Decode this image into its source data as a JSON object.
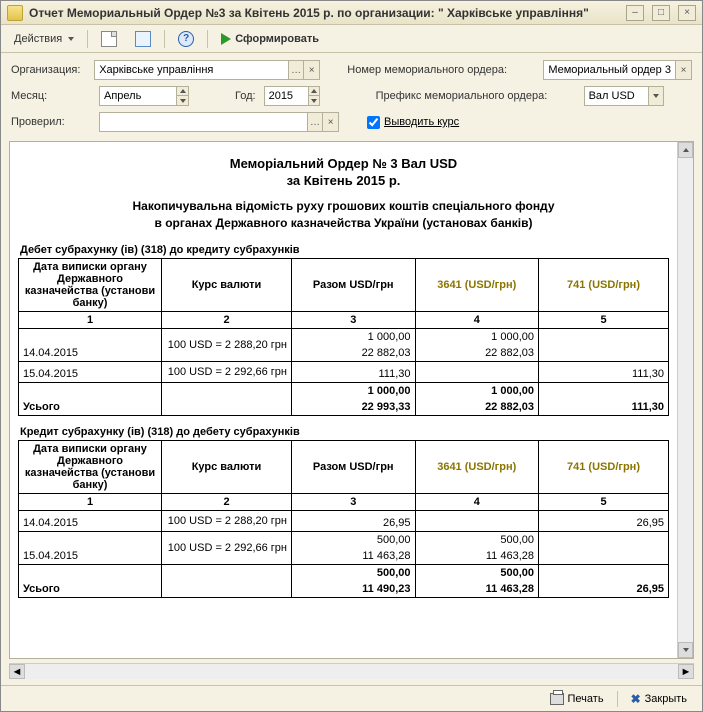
{
  "window": {
    "title": "Отчет Мемориальный Ордер №3 за Квітень 2015 р. по организации: \" Харківське управління\""
  },
  "toolbar": {
    "actions_label": "Действия",
    "generate_label": "Сформировать"
  },
  "form": {
    "org_label": "Организация:",
    "org_value": "Харківське управління",
    "month_label": "Месяц:",
    "month_value": "Апрель",
    "year_label": "Год:",
    "year_value": "2015",
    "verified_label": "Проверил:",
    "verified_value": "",
    "memo_num_label": "Номер мемориального ордера:",
    "memo_num_value": "Мемориальный ордер 3 ...",
    "prefix_label": "Префикс мемориального ордера:",
    "prefix_value": "Вал USD",
    "output_rate_label": "Выводить курс"
  },
  "report": {
    "title": "Меморіальний Ордер № 3 Вал USD",
    "subtitle": "за Квітень 2015 р.",
    "desc1": "Накопичувальна відомість руху грошових коштів спеціального фонду",
    "desc2": "в органах Державного казначейства України (установах банків)",
    "section_debit": "Дебет субрахунку (ів) (318) до кредиту субрахунків",
    "section_credit": "Кредит субрахунку (ів) (318) до дебету субрахунків",
    "headers": {
      "date": "Дата виписки органу Державного казначейства (установи банку)",
      "rate": "Курс валюти",
      "total": "Разом USD/грн",
      "c3641": "3641  (USD/грн)",
      "c741": "741  (USD/грн)",
      "n1": "1",
      "n2": "2",
      "n3": "3",
      "n4": "4",
      "n5": "5"
    },
    "total_label": "Усього",
    "debit_rows": [
      {
        "date": "14.04.2015",
        "rate": "100 USD = 2 288,20 грн",
        "r_usd": "1 000,00",
        "r_uah": "22 882,03",
        "c3641_usd": "1 000,00",
        "c3641_uah": "22 882,03",
        "c741_usd": "",
        "c741_uah": ""
      },
      {
        "date": "15.04.2015",
        "rate": "100 USD = 2 292,66 грн",
        "r_usd": "",
        "r_uah": "111,30",
        "c3641_usd": "",
        "c3641_uah": "",
        "c741_usd": "",
        "c741_uah": "111,30"
      }
    ],
    "debit_total": {
      "r_usd": "1 000,00",
      "r_uah": "22 993,33",
      "c3641_usd": "1 000,00",
      "c3641_uah": "22 882,03",
      "c741_usd": "",
      "c741_uah": "111,30"
    },
    "credit_rows": [
      {
        "date": "14.04.2015",
        "rate": "100 USD = 2 288,20 грн",
        "r_usd": "",
        "r_uah": "26,95",
        "c3641_usd": "",
        "c3641_uah": "",
        "c741_usd": "",
        "c741_uah": "26,95"
      },
      {
        "date": "15.04.2015",
        "rate": "100 USD = 2 292,66 грн",
        "r_usd": "500,00",
        "r_uah": "11 463,28",
        "c3641_usd": "500,00",
        "c3641_uah": "11 463,28",
        "c741_usd": "",
        "c741_uah": ""
      }
    ],
    "credit_total": {
      "r_usd": "500,00",
      "r_uah": "11 490,23",
      "c3641_usd": "500,00",
      "c3641_uah": "11 463,28",
      "c741_usd": "",
      "c741_uah": "26,95"
    }
  },
  "statusbar": {
    "print_label": "Печать",
    "close_label": "Закрыть"
  }
}
